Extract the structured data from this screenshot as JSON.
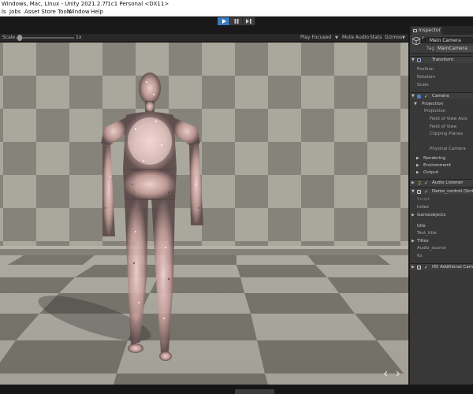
{
  "window": {
    "title": "Windows, Mac, Linux - Unity 2021.2.7f1c1 Personal <DX11>"
  },
  "menu": {
    "items": [
      "ls",
      "Jobs",
      "Asset Store Tools",
      "Window",
      "Help"
    ]
  },
  "game_view": {
    "scale_label": "Scale",
    "scale_value": "1x",
    "play_focused": "Play Focused",
    "mute_audio": "Mute Audio",
    "stats": "Stats",
    "gizmos": "Gizmos"
  },
  "inspector": {
    "tab": "Inspector",
    "object_name": "Main Camera",
    "tag_label": "Tag",
    "tag_value": "MainCamera",
    "transform": {
      "title": "Transform",
      "fields": [
        "Position",
        "Rotation",
        "Scale"
      ]
    },
    "camera": {
      "title": "Camera",
      "projection_header": "Projection",
      "fields": [
        "Projection",
        "Field of View Axis",
        "Field of View",
        "Clipping Planes",
        "Physical Camera"
      ],
      "sections": [
        "Rendering",
        "Environment",
        "Output"
      ]
    },
    "audio_listener": "Audio Listener",
    "demo_control": "Demo_control (Script)",
    "script_fields": [
      "Script",
      "Index"
    ],
    "gameobjects": "Gameobjects",
    "title_field": "title",
    "text_title": "Text_title",
    "titles": "Titles",
    "audio_source": "Audio_source",
    "ks": "Ks",
    "hd_camera": "HD Additional Camera Data"
  },
  "colors": {
    "accent_blue": "#3a79bb",
    "checker_light": "#a9a79c",
    "checker_dark": "#86847a",
    "particle_color": "#e8b9b5"
  },
  "icons": {
    "play": "play-icon",
    "pause": "pause-icon",
    "step": "step-icon",
    "nav": "navigation-arrows-icon"
  }
}
